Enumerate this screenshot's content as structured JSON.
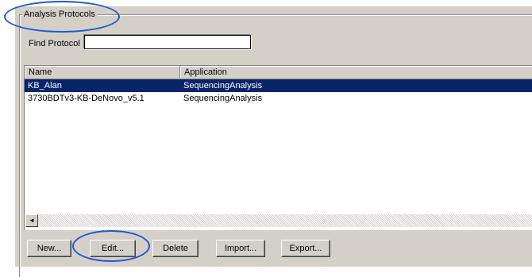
{
  "group": {
    "title": "Analysis Protocols"
  },
  "find": {
    "label": "Find Protocol",
    "value": "",
    "placeholder": ""
  },
  "table": {
    "columns": [
      "Name",
      "Application"
    ],
    "rows": [
      {
        "name": "KB_Alan",
        "application": "SequencingAnalysis",
        "selected": true
      },
      {
        "name": "3730BDTv3-KB-DeNovo_v5.1",
        "application": "SequencingAnalysis",
        "selected": false
      }
    ]
  },
  "scrollbar": {
    "left_arrow": "◄"
  },
  "buttons": {
    "new": "New...",
    "edit": "Edit...",
    "delete": "Delete",
    "import": "Import...",
    "export": "Export..."
  },
  "colors": {
    "selection": "#0a246a",
    "panel": "#d4d0c8",
    "annotation": "#1c58d6"
  }
}
